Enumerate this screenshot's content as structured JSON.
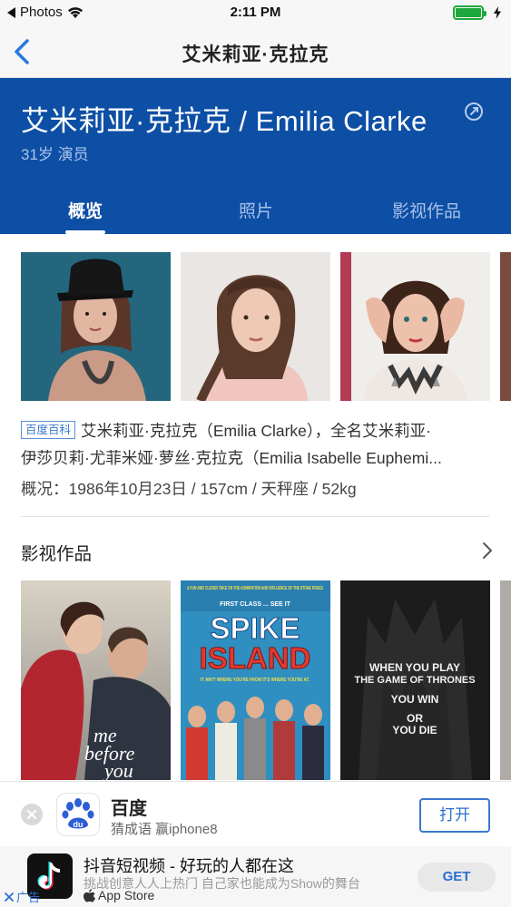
{
  "status_bar": {
    "back_app": "Photos",
    "time": "2:11 PM",
    "battery_level": 1.0
  },
  "nav": {
    "title": "艾米莉亚·克拉克"
  },
  "profile": {
    "name": "艾米莉亚·克拉克 / Emilia Clarke",
    "subtitle": "31岁 演员"
  },
  "tabs": [
    {
      "label": "概览",
      "active": true
    },
    {
      "label": "照片",
      "active": false
    },
    {
      "label": "影视作品",
      "active": false
    }
  ],
  "baike": {
    "source_tag": "百度百科",
    "line1": "艾米莉亚·克拉克（Emilia Clarke），全名艾米莉亚·",
    "line2": "伊莎贝莉·尤菲米娅·萝丝·克拉克（Emilia Isabelle Euphemi...",
    "facts": "概况：1986年10月23日  /  157cm  /  天秤座  /  52kg"
  },
  "works": {
    "title": "影视作品",
    "posters": [
      {
        "title_lines": [
          "me",
          "before",
          "you"
        ]
      },
      {
        "tagline": "A FUN AND CLEVER TAKE ON THE ADMIRATION AND INFLUENCE OF THE STONE ROSES",
        "quote": "FIRST CLASS ... SEE IT",
        "title_top": "SPIKE",
        "title_bottom": "ISLAND",
        "footer": "IT AIN'T WHERE YOU'RE FROM IT'S WHERE YOU'RE AT."
      },
      {
        "lines": [
          "WHEN YOU PLAY",
          "THE GAME OF THRONES",
          "YOU WIN",
          "OR",
          "YOU DIE"
        ]
      }
    ]
  },
  "ad_baidu": {
    "name": "百度",
    "logo_text": "du",
    "desc": "猜成语 赢iphone8",
    "button": "打开"
  },
  "ad_douyin": {
    "title": "抖音短视频 - 好玩的人都在这",
    "subtitle": "挑战创意人人上热门 自己家也能成为Show的舞台",
    "store": "App Store",
    "button": "GET",
    "ad_label": "广告"
  },
  "colors": {
    "header_blue": "#0d4fa5",
    "link_blue": "#2d6fcb",
    "battery_green": "#1fa83b"
  }
}
